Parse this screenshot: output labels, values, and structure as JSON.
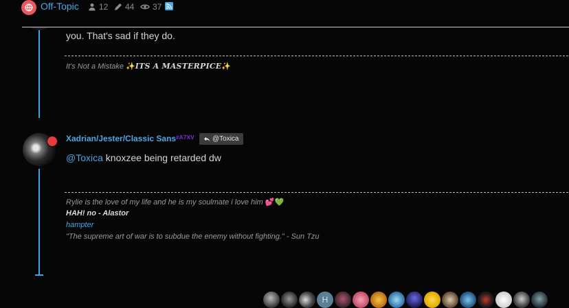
{
  "header": {
    "category": "Off-Topic",
    "posters": "12",
    "posts": "44",
    "views": "37"
  },
  "previous_post": {
    "text_end": "you. That's sad if they do.",
    "signature": {
      "prefix": "It's Not a Mistake",
      "emphasis": "ITS A MASTERPICE"
    }
  },
  "post": {
    "author": "Xadrian/Jester/Classic Sans",
    "tag": "#A7XV",
    "reply_to": "@Toxica",
    "mention": "@Toxica",
    "content": "knoxzee being retarded dw",
    "signature": {
      "line1": "Rylie is the love of my life and he is my soulmate i love him",
      "line1_emoji": "💕💚",
      "line2": "HAH! no - Alastor",
      "line3": "hampter",
      "line4": "\"The supreme art of war is to subdue the enemy without fighting.\" - Sun Tzu"
    }
  },
  "viewers": {
    "initial": "H"
  },
  "colors": {
    "accent": "#4aa8e6",
    "category": "#e8585f",
    "status": "#e83b3b",
    "tag": "#7b2fd8",
    "background": "#060606"
  }
}
